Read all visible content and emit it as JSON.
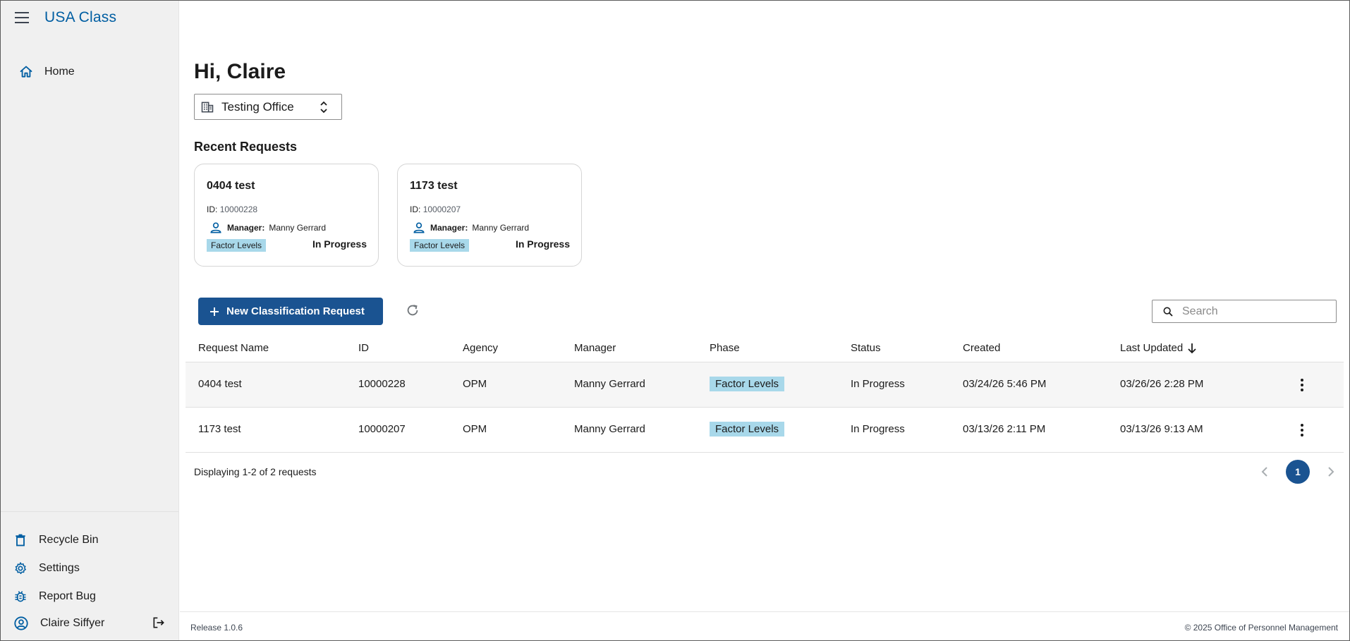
{
  "app": {
    "title": "USA Class"
  },
  "sidebar": {
    "home_label": "Home",
    "bottom_items": [
      {
        "label": "Recycle Bin",
        "icon": "trash-icon"
      },
      {
        "label": "Settings",
        "icon": "gear-icon"
      },
      {
        "label": "Report Bug",
        "icon": "bug-icon"
      }
    ],
    "user_name": "Claire Siffyer"
  },
  "main": {
    "greeting": "Hi, Claire",
    "office": "Testing Office",
    "recent_title": "Recent Requests"
  },
  "recent_cards": [
    {
      "title": "0404 test",
      "id_label": "ID:",
      "id": "10000228",
      "manager_label": "Manager:",
      "manager": "Manny Gerrard",
      "phase": "Factor Levels",
      "status": "In Progress"
    },
    {
      "title": "1173 test",
      "id_label": "ID:",
      "id": "10000207",
      "manager_label": "Manager:",
      "manager": "Manny Gerrard",
      "phase": "Factor Levels",
      "status": "In Progress"
    }
  ],
  "toolbar": {
    "new_button_label": "New Classification Request",
    "search_placeholder": "Search"
  },
  "table": {
    "columns": [
      "Request Name",
      "ID",
      "Agency",
      "Manager",
      "Phase",
      "Status",
      "Created",
      "Last Updated"
    ],
    "rows": [
      {
        "name": "0404 test",
        "id": "10000228",
        "agency": "OPM",
        "manager": "Manny Gerrard",
        "phase": "Factor Levels",
        "status": "In Progress",
        "created": "03/24/26 5:46 PM",
        "updated": "03/26/26 2:28 PM"
      },
      {
        "name": "1173 test",
        "id": "10000207",
        "agency": "OPM",
        "manager": "Manny Gerrard",
        "phase": "Factor Levels",
        "status": "In Progress",
        "created": "03/13/26 2:11 PM",
        "updated": "03/13/26 9:13 AM"
      }
    ]
  },
  "pagination": {
    "summary": "Displaying 1-2 of 2 requests",
    "current_page": "1"
  },
  "footer": {
    "release": "Release 1.0.6",
    "copyright": "© 2025 Office of Personnel Management"
  },
  "colors": {
    "brand": "#005ea2",
    "primary_button": "#1a5391",
    "phase_tag": "#a8d8ea",
    "sidebar_bg": "#f0f0f0"
  }
}
